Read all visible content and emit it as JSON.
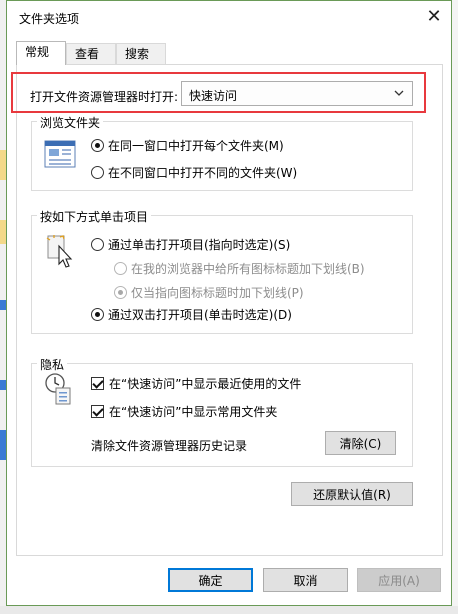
{
  "window": {
    "title": "文件夹选项",
    "close_glyph": "✕"
  },
  "tabs": [
    {
      "label": "常规",
      "active": true
    },
    {
      "label": "查看",
      "active": false
    },
    {
      "label": "搜索",
      "active": false
    }
  ],
  "open_explorer": {
    "label": "打开文件资源管理器时打开:",
    "value": "快速访问"
  },
  "browse_folders": {
    "title": "浏览文件夹",
    "options": [
      {
        "label": "在同一窗口中打开每个文件夹(M)",
        "selected": true
      },
      {
        "label": "在不同窗口中打开不同的文件夹(W)",
        "selected": false
      }
    ]
  },
  "click_items": {
    "title": "按如下方式单击项目",
    "single_click": {
      "label": "通过单击打开项目(指向时选定)(S)",
      "selected": false
    },
    "underline_all": {
      "label": "在我的浏览器中给所有图标标题加下划线(B)",
      "selected": false,
      "disabled": true
    },
    "underline_hover": {
      "label": "仅当指向图标标题时加下划线(P)",
      "selected": true,
      "disabled": true
    },
    "double_click": {
      "label": "通过双击打开项目(单击时选定)(D)",
      "selected": true
    }
  },
  "privacy": {
    "title": "隐私",
    "show_recent": {
      "label": "在“快速访问”中显示最近使用的文件",
      "checked": true
    },
    "show_frequent": {
      "label": "在“快速访问”中显示常用文件夹",
      "checked": true
    },
    "clear_text": "清除文件资源管理器历史记录",
    "clear_button": "清除(C)"
  },
  "restore_button": "还原默认值(R)",
  "footer": {
    "ok": "确定",
    "cancel": "取消",
    "apply": "应用(A)"
  },
  "colors": {
    "highlight": "#e8393e",
    "accent": "#0078d7",
    "window_border": "#6a9a57"
  }
}
